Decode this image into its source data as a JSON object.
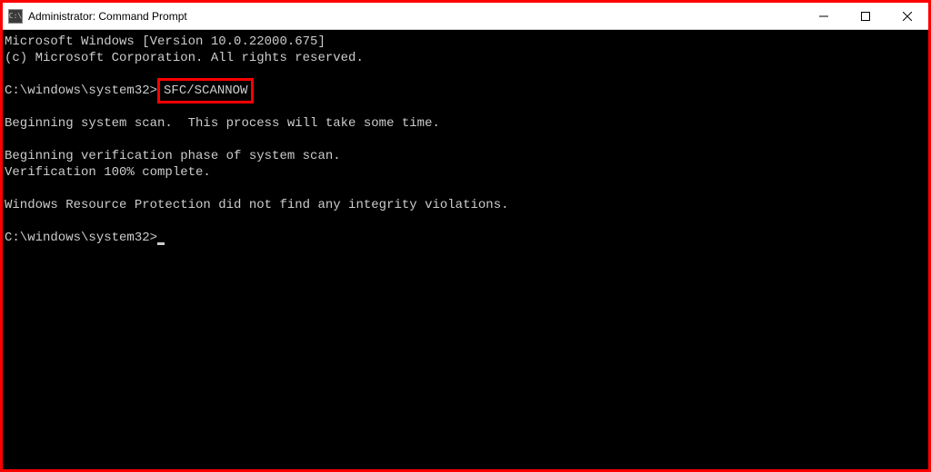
{
  "window": {
    "title": "Administrator: Command Prompt"
  },
  "terminal": {
    "line1": "Microsoft Windows [Version 10.0.22000.675]",
    "line2": "(c) Microsoft Corporation. All rights reserved.",
    "prompt1_path": "C:\\windows\\system32>",
    "command1": "SFC/SCANNOW",
    "line3": "Beginning system scan.  This process will take some time.",
    "line4": "Beginning verification phase of system scan.",
    "line5": "Verification 100% complete.",
    "line6": "Windows Resource Protection did not find any integrity violations.",
    "prompt2_path": "C:\\windows\\system32>"
  }
}
